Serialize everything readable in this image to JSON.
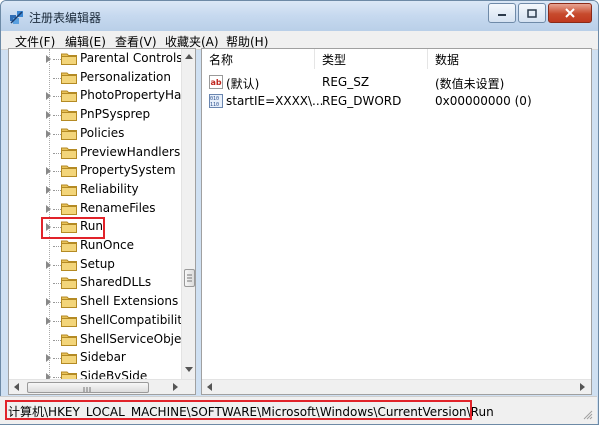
{
  "window": {
    "title": "注册表编辑器",
    "accent_color": "#c74a2d",
    "app_icon": "registry-editor-icon"
  },
  "menu": {
    "items": [
      "文件(F)",
      "编辑(E)",
      "查看(V)",
      "收藏夹(A)",
      "帮助(H)"
    ]
  },
  "tree": {
    "items": [
      {
        "label": "Parental Controls",
        "has_children": true
      },
      {
        "label": "Personalization",
        "has_children": false
      },
      {
        "label": "PhotoPropertyHan",
        "has_children": true
      },
      {
        "label": "PnPSysprep",
        "has_children": true
      },
      {
        "label": "Policies",
        "has_children": true
      },
      {
        "label": "PreviewHandlers",
        "has_children": false
      },
      {
        "label": "PropertySystem",
        "has_children": true
      },
      {
        "label": "Reliability",
        "has_children": true
      },
      {
        "label": "RenameFiles",
        "has_children": true
      },
      {
        "label": "Run",
        "has_children": true,
        "selected": true
      },
      {
        "label": "RunOnce",
        "has_children": false
      },
      {
        "label": "Setup",
        "has_children": true
      },
      {
        "label": "SharedDLLs",
        "has_children": false
      },
      {
        "label": "Shell Extensions",
        "has_children": true
      },
      {
        "label": "ShellCompatibility",
        "has_children": true
      },
      {
        "label": "ShellServiceObjectI",
        "has_children": false
      },
      {
        "label": "Sidebar",
        "has_children": true
      },
      {
        "label": "SideBySide",
        "has_children": true
      }
    ]
  },
  "list": {
    "columns": [
      "名称",
      "类型",
      "数据"
    ],
    "rows": [
      {
        "name": "(默认)",
        "type": "REG_SZ",
        "data": "(数值未设置)",
        "icon": "string-value-icon"
      },
      {
        "name": "startIE=XXXX\\...",
        "type": "REG_DWORD",
        "data": "0x00000000 (0)",
        "icon": "dword-value-icon"
      }
    ]
  },
  "status": {
    "path": "计算机\\HKEY_LOCAL_MACHINE\\SOFTWARE\\Microsoft\\Windows\\CurrentVersion\\Run"
  },
  "highlight_color": "#e1232a"
}
